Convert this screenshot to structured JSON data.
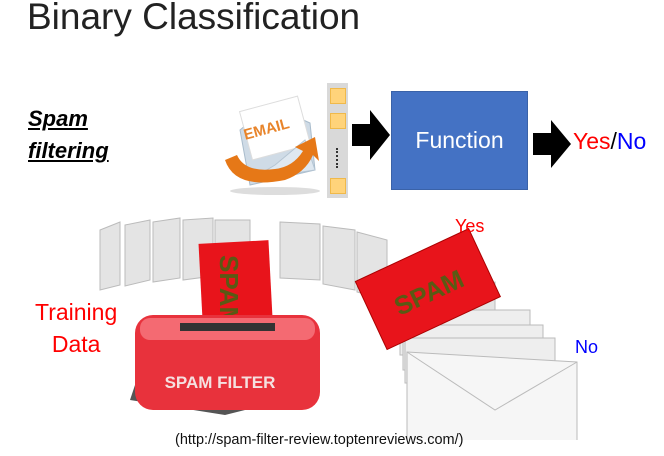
{
  "title": "Binary Classification",
  "spam_label": {
    "line1": "Spam",
    "line2": "filtering"
  },
  "email_icon_text": "EMAIL",
  "function_label": "Function",
  "output": {
    "yes": "Yes",
    "slash": "/",
    "no": "No"
  },
  "training_label": {
    "line1": "Training",
    "line2": "Data"
  },
  "illustration": {
    "spam_text": "SPAM",
    "filter_text": "SPAM FILTER",
    "yes": "Yes",
    "no": "No"
  },
  "citation": "(http://spam-filter-review.toptenreviews.com/)",
  "colors": {
    "function_box": "#4472C4",
    "yes": "#FF0000",
    "no": "#0000FF",
    "spam_red": "#E8141B"
  }
}
